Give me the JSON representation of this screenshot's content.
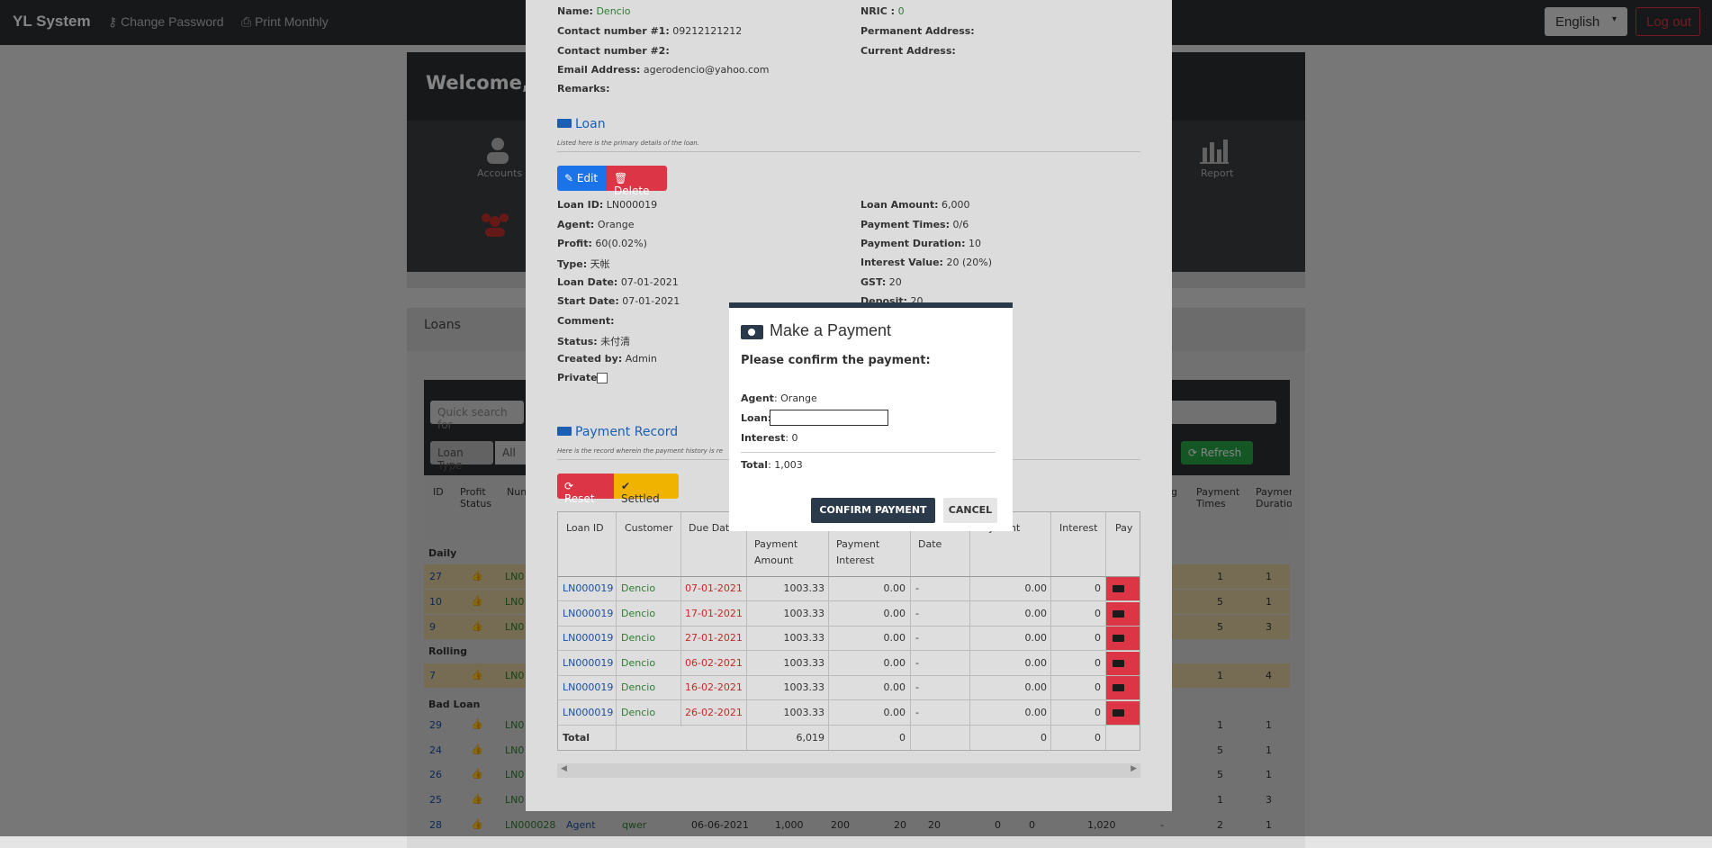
{
  "nav": {
    "brand": "YL System",
    "change_password": "Change Password",
    "print_monthly": "Print Monthly",
    "language": "English",
    "logout": "Log out"
  },
  "background": {
    "welcome": "Welcome, A",
    "tiles": {
      "accounts": "Accounts",
      "report": "Report"
    },
    "loans_title": "Loans",
    "search_placeholder": "Quick search for",
    "loan_type_label": "Loan Type",
    "loan_type_value": "All",
    "refresh": "Refresh",
    "headers": [
      "ID",
      "Profit Status",
      "Num",
      "g",
      "Payment Times",
      "Payment Duratio"
    ],
    "groups": {
      "daily": "Daily",
      "rolling": "Rolling",
      "bad_loan": "Bad Loan"
    },
    "rows": [
      {
        "id": "27",
        "times": "1",
        "dur": "1"
      },
      {
        "id": "10",
        "times": "5",
        "dur": "1"
      },
      {
        "id": "9",
        "times": "5",
        "dur": "3"
      },
      {
        "id": "7",
        "times": "1",
        "dur": "4"
      },
      {
        "id": "29",
        "times": "1",
        "dur": "1"
      },
      {
        "id": "24",
        "times": "5",
        "dur": "1"
      },
      {
        "id": "26",
        "times": "5",
        "dur": "1"
      },
      {
        "id": "25",
        "times": "1",
        "dur": "3"
      }
    ],
    "last_row": {
      "id": "28",
      "loan": "LN000028",
      "agent": "Agent",
      "cust": "qwer",
      "date": "06-06-2021",
      "a": "1,000",
      "b": "200",
      "c": "20",
      "d": "20",
      "e": "0",
      "f": "0",
      "g": "1,020",
      "h": "-",
      "times": "2",
      "dur": "1"
    },
    "ln_prefix": "LN0"
  },
  "customer": {
    "name_label": "Name:",
    "name": "Dencio",
    "nric_label": "NRIC :",
    "nric": "0",
    "contact1_label": "Contact number #1:",
    "contact1": "09212121212",
    "contact2_label": "Contact number #2:",
    "perm_label": "Permanent Address:",
    "curr_label": "Current Address:",
    "email_label": "Email Address:",
    "email": "agerodencio@yahoo.com",
    "remarks_label": "Remarks:"
  },
  "loan": {
    "title": "Loan",
    "subtitle": "Listed here is the primary details of the loan.",
    "edit": "Edit",
    "delete": "Delete",
    "left": [
      {
        "label": "Loan ID:",
        "value": "LN000019"
      },
      {
        "label": "Agent:",
        "value": "Orange"
      },
      {
        "label": "Profit:",
        "value": "60(0.02%)"
      },
      {
        "label": "Type:",
        "value": "天帐"
      },
      {
        "label": "Loan Date:",
        "value": "07-01-2021"
      },
      {
        "label": "Start Date:",
        "value": "07-01-2021"
      },
      {
        "label": "Comment:",
        "value": ""
      },
      {
        "label": "Status:",
        "value": "未付清"
      },
      {
        "label": "Created by:",
        "value": "Admin"
      },
      {
        "label": "Private:",
        "value": ""
      }
    ],
    "right": [
      {
        "label": "Loan Amount:",
        "value": "6,000"
      },
      {
        "label": "Payment Times:",
        "value": "0/6"
      },
      {
        "label": "Payment Duration:",
        "value": "10"
      },
      {
        "label": "Interest Value:",
        "value": "20 (20%)"
      },
      {
        "label": "GST:",
        "value": "20"
      },
      {
        "label": "Deposit:",
        "value": "20"
      }
    ]
  },
  "payment_record": {
    "title": "Payment Record",
    "subtitle": "Here is the record wherein the payment history is re",
    "reset": "Reset",
    "settled": "Settled",
    "headers": [
      "Loan ID",
      "Customer",
      "Due Date",
      "Payment Amount",
      "Payment Interest",
      "Date",
      "yment",
      "Interest",
      "Pay"
    ],
    "rows": [
      {
        "loan": "LN000019",
        "customer": "Dencio",
        "due": "07-01-2021",
        "amount": "1003.33",
        "interest": "0.00",
        "date": "-",
        "pay": "0.00",
        "int2": "0"
      },
      {
        "loan": "LN000019",
        "customer": "Dencio",
        "due": "17-01-2021",
        "amount": "1003.33",
        "interest": "0.00",
        "date": "-",
        "pay": "0.00",
        "int2": "0"
      },
      {
        "loan": "LN000019",
        "customer": "Dencio",
        "due": "27-01-2021",
        "amount": "1003.33",
        "interest": "0.00",
        "date": "-",
        "pay": "0.00",
        "int2": "0"
      },
      {
        "loan": "LN000019",
        "customer": "Dencio",
        "due": "06-02-2021",
        "amount": "1003.33",
        "interest": "0.00",
        "date": "-",
        "pay": "0.00",
        "int2": "0"
      },
      {
        "loan": "LN000019",
        "customer": "Dencio",
        "due": "16-02-2021",
        "amount": "1003.33",
        "interest": "0.00",
        "date": "-",
        "pay": "0.00",
        "int2": "0"
      },
      {
        "loan": "LN000019",
        "customer": "Dencio",
        "due": "26-02-2021",
        "amount": "1003.33",
        "interest": "0.00",
        "date": "-",
        "pay": "0.00",
        "int2": "0"
      }
    ],
    "total": {
      "label": "Total",
      "amount": "6,019",
      "interest": "0",
      "pay": "0",
      "int2": "0"
    }
  },
  "dialog": {
    "title": "Make a Payment",
    "prompt": "Please confirm the payment:",
    "agent_label": "Agent",
    "agent": ": Orange",
    "loan_label": "Loan:",
    "loan_value": "",
    "interest_label": "Interest",
    "interest": ": 0",
    "total_label": "Total",
    "total": ": 1,003",
    "confirm": "CONFIRM PAYMENT",
    "cancel": "CANCEL"
  },
  "colors": {
    "primary": "#1a73e8",
    "danger": "#dc3545",
    "warning": "#f0b400",
    "success": "#28a745",
    "dark": "#2b2f33"
  }
}
